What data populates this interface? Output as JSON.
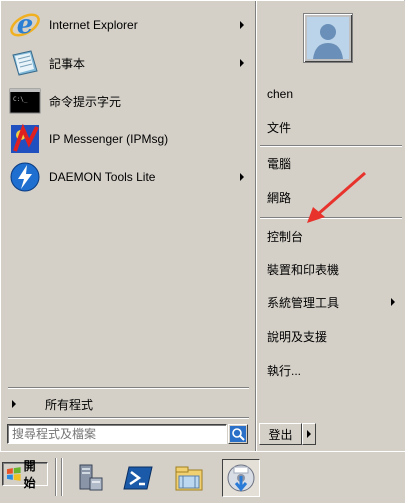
{
  "programs": [
    {
      "label": "Internet Explorer",
      "icon": "internet-explorer-icon",
      "has_submenu": true
    },
    {
      "label": "記事本",
      "icon": "notepad-icon",
      "has_submenu": true
    },
    {
      "label": "命令提示字元",
      "icon": "command-prompt-icon",
      "has_submenu": false
    },
    {
      "label": "IP Messenger (IPMsg)",
      "icon": "ip-messenger-icon",
      "has_submenu": false
    },
    {
      "label": "DAEMON Tools Lite",
      "icon": "daemon-tools-icon",
      "has_submenu": true
    }
  ],
  "all_programs": {
    "label": "所有程式"
  },
  "search": {
    "placeholder": "搜尋程式及檔案",
    "value": "搜尋程式及檔案"
  },
  "user": {
    "name": "chen"
  },
  "right_items": [
    {
      "label": "文件",
      "has_submenu": false
    },
    {
      "label": "電腦",
      "has_submenu": false
    },
    {
      "label": "網路",
      "has_submenu": false
    },
    {
      "label": "控制台",
      "has_submenu": false
    },
    {
      "label": "裝置和印表機",
      "has_submenu": false
    },
    {
      "label": "系統管理工具",
      "has_submenu": true
    },
    {
      "label": "說明及支援",
      "has_submenu": false
    },
    {
      "label": "執行...",
      "has_submenu": false
    }
  ],
  "logoff": {
    "label": "登出"
  },
  "taskbar": {
    "start_label": "開始",
    "icons": [
      "server-manager-icon",
      "powershell-icon",
      "windows-explorer-icon",
      "installer-icon"
    ]
  },
  "colors": {
    "menu_bg": "#d4d0c8",
    "annotation_arrow": "#e8322c"
  }
}
